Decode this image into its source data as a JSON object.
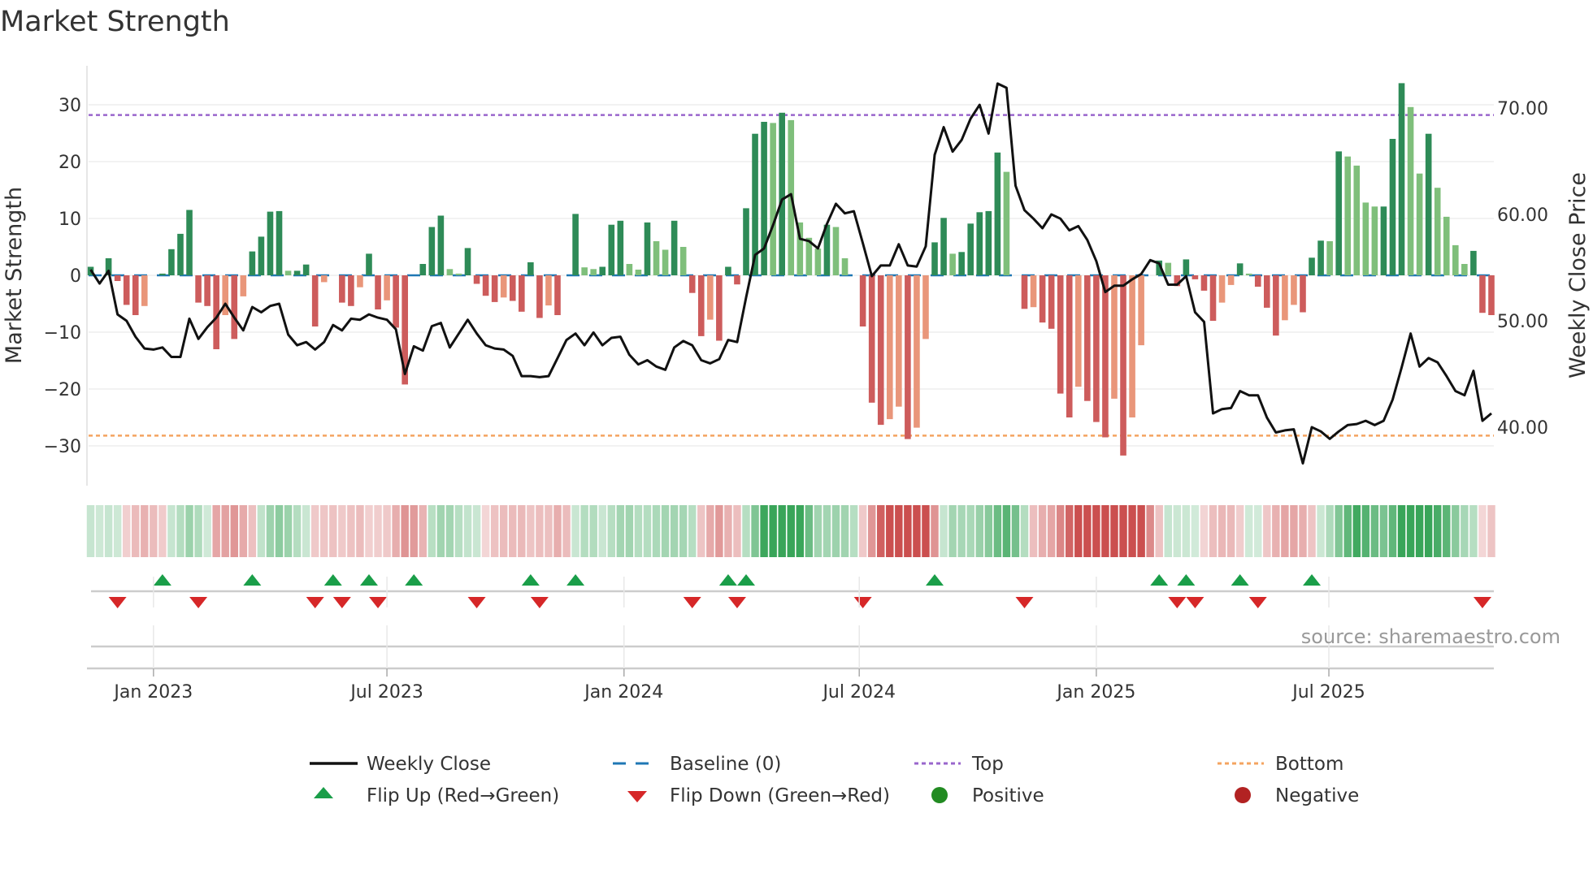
{
  "chart_data": {
    "type": "bar",
    "title": "Market Strength",
    "ylabel": "Market Strength",
    "y2label": "Weekly Close Price",
    "ylim": [
      -37,
      37
    ],
    "y2lim": [
      34.6,
      73.9
    ],
    "yticks": [
      -30,
      -20,
      -10,
      0,
      10,
      20,
      30
    ],
    "y2ticks": [
      "40.00",
      "50.00",
      "60.00",
      "70.00"
    ],
    "x_unit": "week index",
    "xticks": [
      {
        "label": "Jan 2023",
        "week": 7.0
      },
      {
        "label": "Jul 2023",
        "week": 33.0
      },
      {
        "label": "Jan 2024",
        "week": 59.4
      },
      {
        "label": "Jul 2024",
        "week": 85.6
      },
      {
        "label": "Jan 2025",
        "week": 112.0
      },
      {
        "label": "Jul 2025",
        "week": 137.9
      }
    ],
    "top_level": 28.2,
    "bottom_level": -28.2,
    "baseline": 0,
    "strength": [
      1.5,
      0,
      3,
      -1,
      -5.2,
      -7,
      -5.4,
      0,
      0.3,
      4.6,
      7.3,
      11.5,
      -4.8,
      -5.4,
      -13,
      -7,
      -11.2,
      -3.7,
      4.2,
      6.8,
      11.2,
      11.3,
      0.8,
      0.8,
      1.9,
      -9,
      -1.2,
      0,
      -4.8,
      -5.4,
      -2.1,
      3.8,
      -6,
      -4.4,
      -9.2,
      -19.2,
      0,
      2,
      8.5,
      10.5,
      1.1,
      0.3,
      4.8,
      -1.5,
      -3.6,
      -4.7,
      -3.9,
      -4.5,
      -6.4,
      2.3,
      -7.5,
      -5.3,
      -7,
      0,
      10.8,
      1.4,
      1.1,
      1.5,
      8.9,
      9.6,
      2,
      1,
      9.3,
      6,
      4.5,
      9.6,
      5,
      -3.1,
      -10.7,
      -7.8,
      -11.5,
      1.5,
      -1.6,
      11.8,
      24.9,
      27,
      26.8,
      28.6,
      27.3,
      9.3,
      6.6,
      4.7,
      8.9,
      8.5,
      3,
      0,
      -9,
      -22.4,
      -26.3,
      -25.3,
      -23.1,
      -28.8,
      -26.8,
      -11.2,
      5.8,
      10.1,
      3.8,
      4.1,
      9.1,
      11.1,
      11.3,
      21.6,
      18.2,
      0,
      -5.9,
      -5.6,
      -8.3,
      -9.4,
      -20.8,
      -25,
      -19.6,
      -22.1,
      -25.8,
      -28.5,
      -21.7,
      -31.7,
      -25,
      -12.3,
      0,
      2.6,
      2.2,
      -1.9,
      2.8,
      -0.7,
      -2.7,
      -8,
      -4.8,
      -1.7,
      2.1,
      0.3,
      -2,
      -5.7,
      -10.6,
      -7.9,
      -5.2,
      -6.5,
      3.1,
      6.1,
      6,
      21.8,
      20.9,
      19.3,
      12.8,
      12.1,
      12.1,
      24,
      33.8,
      29.6,
      17.9,
      24.9,
      15.4,
      10.3,
      5.3,
      2,
      4.3,
      -6.6,
      -7
    ],
    "weekly_close": [
      54.8,
      53.5,
      54.7,
      50.6,
      50.0,
      48.5,
      47.4,
      47.3,
      47.5,
      46.6,
      46.6,
      50.2,
      48.3,
      49.4,
      50.3,
      51.6,
      50.3,
      49.1,
      51.3,
      50.8,
      51.4,
      51.6,
      48.7,
      47.7,
      48.0,
      47.3,
      48.0,
      49.6,
      49.1,
      50.2,
      50.1,
      50.6,
      50.3,
      50.1,
      49.2,
      45.0,
      47.6,
      47.2,
      49.5,
      49.8,
      47.5,
      48.8,
      50.1,
      48.8,
      47.7,
      47.4,
      47.3,
      46.7,
      44.8,
      44.8,
      44.7,
      44.8,
      46.5,
      48.2,
      48.8,
      47.7,
      48.9,
      47.7,
      48.4,
      48.5,
      46.8,
      45.9,
      46.3,
      45.7,
      45.4,
      47.5,
      48.1,
      47.7,
      46.3,
      46.0,
      46.4,
      48.2,
      48.0,
      52.2,
      56.2,
      56.8,
      59.0,
      61.4,
      61.9,
      57.7,
      57.5,
      56.8,
      59.1,
      61.0,
      60.1,
      60.3,
      57.3,
      54.2,
      55.2,
      55.2,
      57.2,
      55.2,
      55.1,
      57.0,
      65.6,
      68.2,
      65.9,
      67.0,
      69.0,
      70.3,
      67.6,
      72.3,
      71.9,
      62.7,
      60.4,
      59.6,
      58.7,
      60.0,
      59.6,
      58.5,
      58.9,
      57.6,
      55.6,
      52.7,
      53.3,
      53.3,
      53.9,
      54.4,
      55.7,
      55.4,
      53.4,
      53.4,
      54.2,
      50.8,
      49.9,
      41.3,
      41.7,
      41.8,
      43.4,
      43.0,
      43.0,
      40.9,
      39.5,
      39.7,
      39.8,
      36.6,
      40.0,
      39.6,
      38.9,
      39.6,
      40.2,
      40.3,
      40.6,
      40.2,
      40.6,
      42.6,
      45.6,
      48.8,
      45.7,
      46.5,
      46.1,
      44.8,
      43.4,
      43.0,
      45.3,
      40.6,
      41.3
    ],
    "flip_up_weeks": [
      8,
      18,
      27,
      31,
      36,
      49,
      54,
      71,
      73,
      94,
      119,
      122,
      128,
      136
    ],
    "flip_down_weeks": [
      3,
      12,
      25,
      28,
      32,
      43,
      50,
      67,
      72,
      86,
      104,
      121,
      123,
      130,
      155
    ],
    "legend": {
      "weekly_close": "Weekly Close",
      "baseline": "Baseline (0)",
      "top": "Top",
      "bottom": "Bottom",
      "flip_up": "Flip Up (Red→Green)",
      "flip_down": "Flip Down (Green→Red)",
      "positive": "Positive",
      "negative": "Negative"
    },
    "source": "source: sharemaestro.com",
    "colors": {
      "pos_strong": "#2e8b57",
      "pos_weak": "#7fbf7b",
      "neg_strong": "#cd5c5c",
      "neg_weak": "#e9967a",
      "line": "#111111",
      "baseline": "#1f77b4",
      "top": "#9966cc",
      "bottom": "#f4a460",
      "flip_up": "#1a9e49",
      "flip_down": "#d62728",
      "positive_dot": "#228b22",
      "negative_dot": "#b22222"
    }
  }
}
